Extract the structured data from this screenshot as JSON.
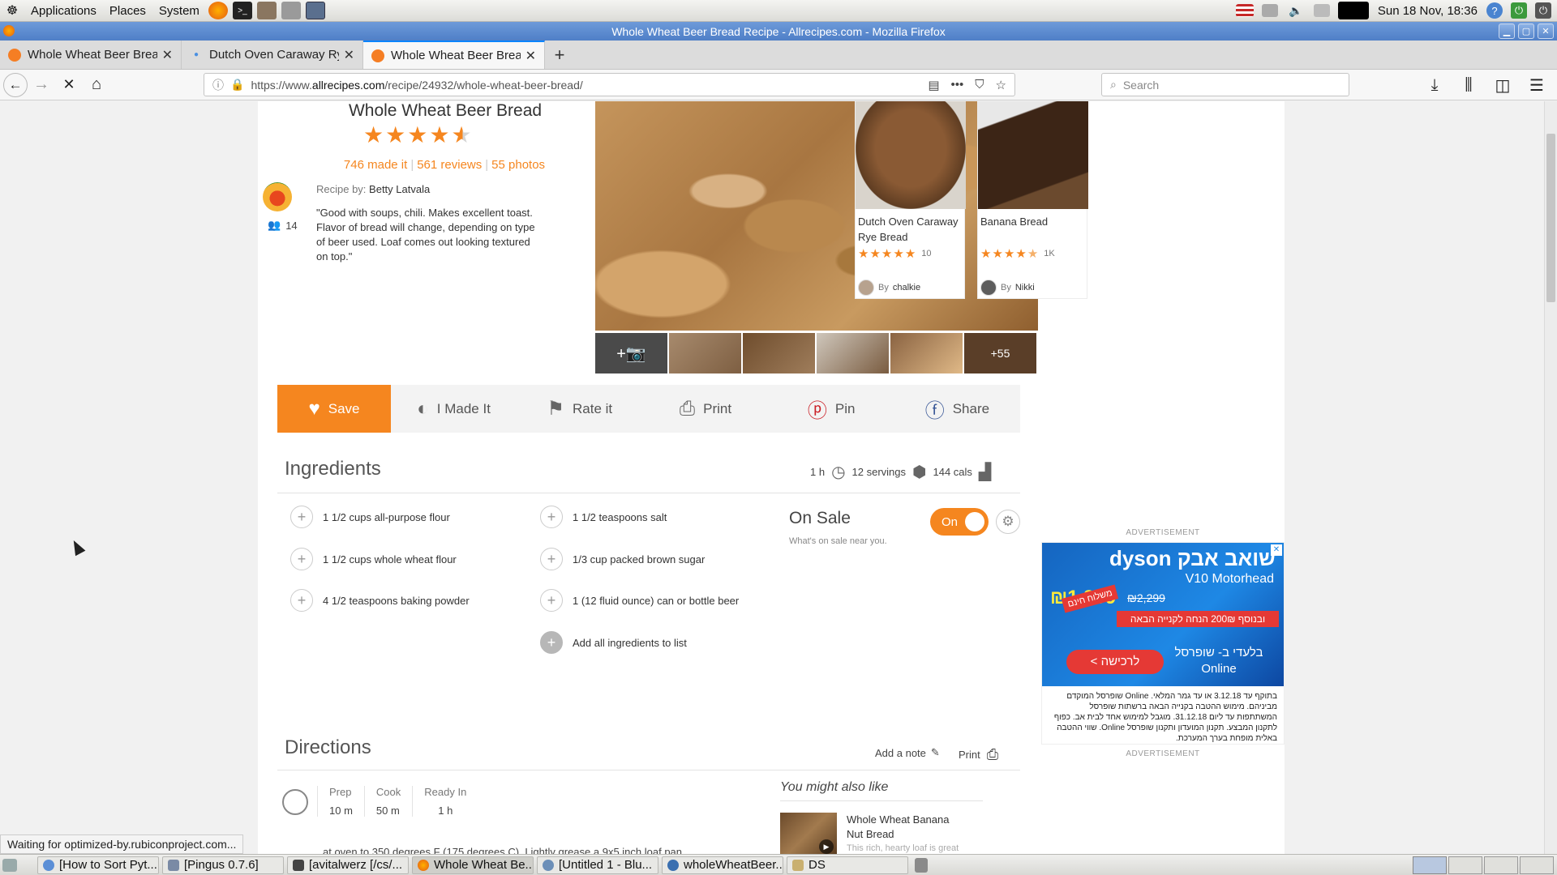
{
  "panel": {
    "menus": [
      "Applications",
      "Places",
      "System"
    ],
    "clock": "Sun 18 Nov, 18:36"
  },
  "window": {
    "title": "Whole Wheat Beer Bread Recipe - Allrecipes.com - Mozilla Firefox"
  },
  "tabs": [
    {
      "title": "Whole Wheat Beer Bread",
      "active": false
    },
    {
      "title": "Dutch Oven Caraway Rye",
      "active": false
    },
    {
      "title": "Whole Wheat Beer Bread",
      "active": true
    }
  ],
  "navbar": {
    "url_prefix": "https://www.",
    "url_host": "allrecipes.com",
    "url_path": "/recipe/24932/whole-wheat-beer-bread/",
    "search_placeholder": "Search"
  },
  "recipe": {
    "title": "Whole Wheat Beer Bread",
    "rating": 4.5,
    "made_it": "746 made it",
    "reviews": "561 reviews",
    "photos": "55 photos",
    "recipe_by_label": "Recipe by:",
    "author": "Betty Latvala",
    "followers": "14",
    "description": "\"Good with soups, chili. Makes excellent toast. Flavor of bread will change, depending on type of beer used. Loaf comes out looking textured on top.\"",
    "more_photos": "+55"
  },
  "related": [
    {
      "title": "Dutch Oven Caraway Rye Bread",
      "stars": 5,
      "count": "10",
      "by": "By",
      "author": "chalkie"
    },
    {
      "title": "Banana Bread",
      "stars": 4.5,
      "count": "1K",
      "by": "By",
      "author": "Nikki"
    }
  ],
  "actions": {
    "save": "Save",
    "made_it": "I Made It",
    "rate": "Rate it",
    "print": "Print",
    "pin": "Pin",
    "share": "Share"
  },
  "ingredients": {
    "heading": "Ingredients",
    "time": "1 h",
    "servings": "12 servings",
    "cals": "144 cals",
    "items": [
      "1 1/2 cups all-purpose flour",
      "1 1/2 cups whole wheat flour",
      "4 1/2 teaspoons baking powder",
      "1 1/2 teaspoons salt",
      "1/3 cup packed brown sugar",
      "1 (12 fluid ounce) can or bottle beer"
    ],
    "add_all": "Add all ingredients to list",
    "on_sale_title": "On Sale",
    "on_sale_sub": "What's on sale near you.",
    "toggle": "On"
  },
  "directions": {
    "heading": "Directions",
    "add_note": "Add a note",
    "print": "Print",
    "prep_label": "Prep",
    "prep": "10 m",
    "cook_label": "Cook",
    "cook": "50 m",
    "ready_label": "Ready In",
    "ready": "1 h",
    "step_partial": "at oven to 350 degrees F (175 degrees C). Lightly grease a 9x5 inch loaf pan."
  },
  "also_like": {
    "heading": "You might also like",
    "title": "Whole Wheat Banana Nut Bread",
    "sub": "This rich, hearty loaf is great"
  },
  "ad": {
    "label": "ADVERTISEMENT",
    "brand": "dyson שואב אבק",
    "model": "V10 Motorhead",
    "price": "1,999",
    "old_price": "2,299",
    "ribbon": "ובנוסף 200₪ הנחה לקנייה הבאה",
    "ship": "משלוח חינם",
    "store": "בלעדי ב- שופרסל Online",
    "cta": "לרכישה >",
    "fineprint": "בתוקף עד 3.12.18 או עד גמר המלאי. Online שופרסל המוקדם מביניהם. מימוש ההטבה בקנייה הבאה ברשתות שופרסל המשתתפות עד ליום 31.12.18. מוגבל למימוש אחד לבית אב. כפוף לתקנון המבצע. תקנון המועדון ותקנון שופרסל Online. שווי ההטבה באלית מופחת בערך המערכת."
  },
  "status": "Waiting for optimized-by.rubiconproject.com...",
  "taskbar": [
    {
      "label": "[How to Sort Pyt...",
      "active": false
    },
    {
      "label": "[Pingus 0.7.6]",
      "active": false
    },
    {
      "label": "[avitalwerz [/cs/...",
      "active": false
    },
    {
      "label": "Whole Wheat Be...",
      "active": true
    },
    {
      "label": "[Untitled 1 - Blu...",
      "active": false
    },
    {
      "label": "wholeWheatBeer...",
      "active": false
    },
    {
      "label": "DS",
      "active": false
    }
  ]
}
